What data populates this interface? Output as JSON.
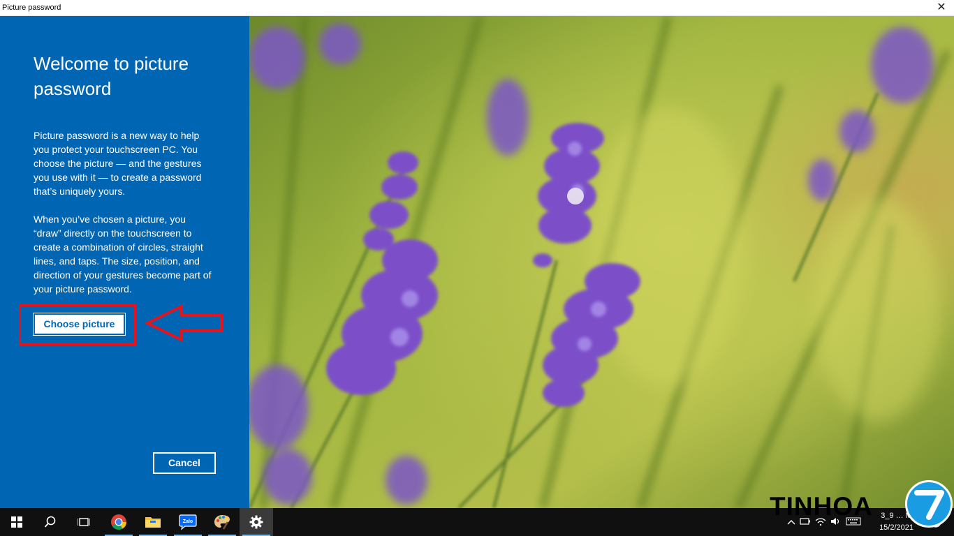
{
  "window": {
    "title": "Picture password",
    "close_glyph": "✕"
  },
  "panel": {
    "heading": "Welcome to picture password",
    "paragraph1": "Picture password is a new way to help you protect your touchscreen PC. You choose the picture — and the gestures you use with it — to create a password that’s uniquely yours.",
    "paragraph2": "When you’ve chosen a picture, you “draw” directly on the touchscreen to create a combination of circles, straight lines, and taps. The size, position, and direction of your gestures become part of your picture password.",
    "choose_label": "Choose picture",
    "cancel_label": "Cancel"
  },
  "annotation": {
    "color": "#e8121a"
  },
  "taskbar": {
    "items": [
      {
        "name": "start-icon"
      },
      {
        "name": "search-icon"
      },
      {
        "name": "task-view-icon"
      },
      {
        "name": "chrome-icon"
      },
      {
        "name": "file-explorer-icon"
      },
      {
        "name": "zalo-icon",
        "label": "Zalo"
      },
      {
        "name": "paint-icon"
      },
      {
        "name": "settings-icon"
      }
    ],
    "clock_time": "3_9 … M",
    "clock_date": "15/2/2021"
  },
  "watermark": {
    "text": "TINHOA",
    "logo_text": "7"
  },
  "colors": {
    "panel_blue": "#0066b4",
    "taskbar": "#101010",
    "accent": "#76b9ed"
  }
}
